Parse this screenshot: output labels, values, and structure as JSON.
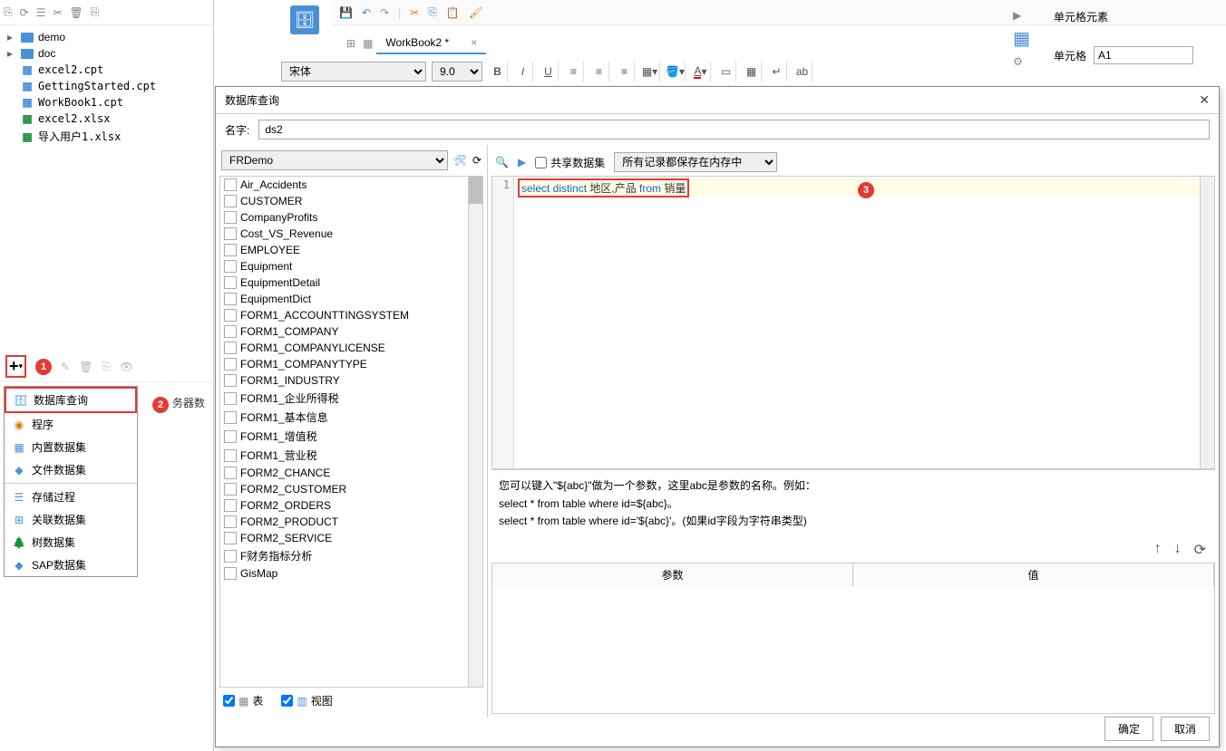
{
  "left_toolbar_icons": [
    "new",
    "refresh",
    "copy",
    "cut",
    "delete",
    "paste"
  ],
  "file_tree": [
    {
      "type": "folder",
      "name": "demo"
    },
    {
      "type": "folder",
      "name": "doc"
    },
    {
      "type": "cpt",
      "name": "excel2.cpt"
    },
    {
      "type": "cpt",
      "name": "GettingStarted.cpt"
    },
    {
      "type": "cpt",
      "name": "WorkBook1.cpt"
    },
    {
      "type": "xlsx",
      "name": "excel2.xlsx"
    },
    {
      "type": "xlsx",
      "name": "导入用户1.xlsx"
    }
  ],
  "ds_menu": {
    "items_top": [
      {
        "label": "数据库查询",
        "icon": "db",
        "selected": true
      },
      {
        "label": "程序",
        "icon": "disc"
      },
      {
        "label": "内置数据集",
        "icon": "grid"
      },
      {
        "label": "文件数据集",
        "icon": "file"
      }
    ],
    "items_bottom": [
      {
        "label": "存储过程",
        "icon": "proc"
      },
      {
        "label": "关联数据集",
        "icon": "join"
      },
      {
        "label": "树数据集",
        "icon": "tree"
      },
      {
        "label": "SAP数据集",
        "icon": "sap"
      }
    ]
  },
  "srv_label": "务器数",
  "tab": {
    "label": "WorkBook2 *"
  },
  "font_name": "宋体",
  "font_size": "9.0",
  "right": {
    "panel_title": "单元格元素",
    "cell_label": "单元格",
    "cell_value": "A1"
  },
  "dialog": {
    "title": "数据库查询",
    "name_label": "名字:",
    "name_value": "ds2",
    "db_select": "FRDemo",
    "tables": [
      "Air_Accidents",
      "CUSTOMER",
      "CompanyProfits",
      "Cost_VS_Revenue",
      "EMPLOYEE",
      "Equipment",
      "EquipmentDetail",
      "EquipmentDict",
      "FORM1_ACCOUNTTINGSYSTEM",
      "FORM1_COMPANY",
      "FORM1_COMPANYLICENSE",
      "FORM1_COMPANYTYPE",
      "FORM1_INDUSTRY",
      "FORM1_企业所得税",
      "FORM1_基本信息",
      "FORM1_增值税",
      "FORM1_营业税",
      "FORM2_CHANCE",
      "FORM2_CUSTOMER",
      "FORM2_ORDERS",
      "FORM2_PRODUCT",
      "FORM2_SERVICE",
      "F财务指标分析",
      "GisMap"
    ],
    "check_table": "表",
    "check_view": "视图",
    "share_label": "共享数据集",
    "memory_select": "所有记录都保存在内存中",
    "sql_kw1": "select distinct",
    "sql_txt1": " 地区,产品 ",
    "sql_kw2": "from",
    "sql_txt2": " 销量",
    "hint_line1": "您可以键入\"${abc}\"做为一个参数，这里abc是参数的名称。例如：",
    "hint_line2": "select * from table where id=${abc}。",
    "hint_line3": "select * from table where id='${abc}'。(如果id字段为字符串类型)",
    "param_col1": "参数",
    "param_col2": "值",
    "btn_ok": "确定",
    "btn_cancel": "取消"
  },
  "annotations": {
    "a1": "1",
    "a2": "2",
    "a3": "3"
  }
}
